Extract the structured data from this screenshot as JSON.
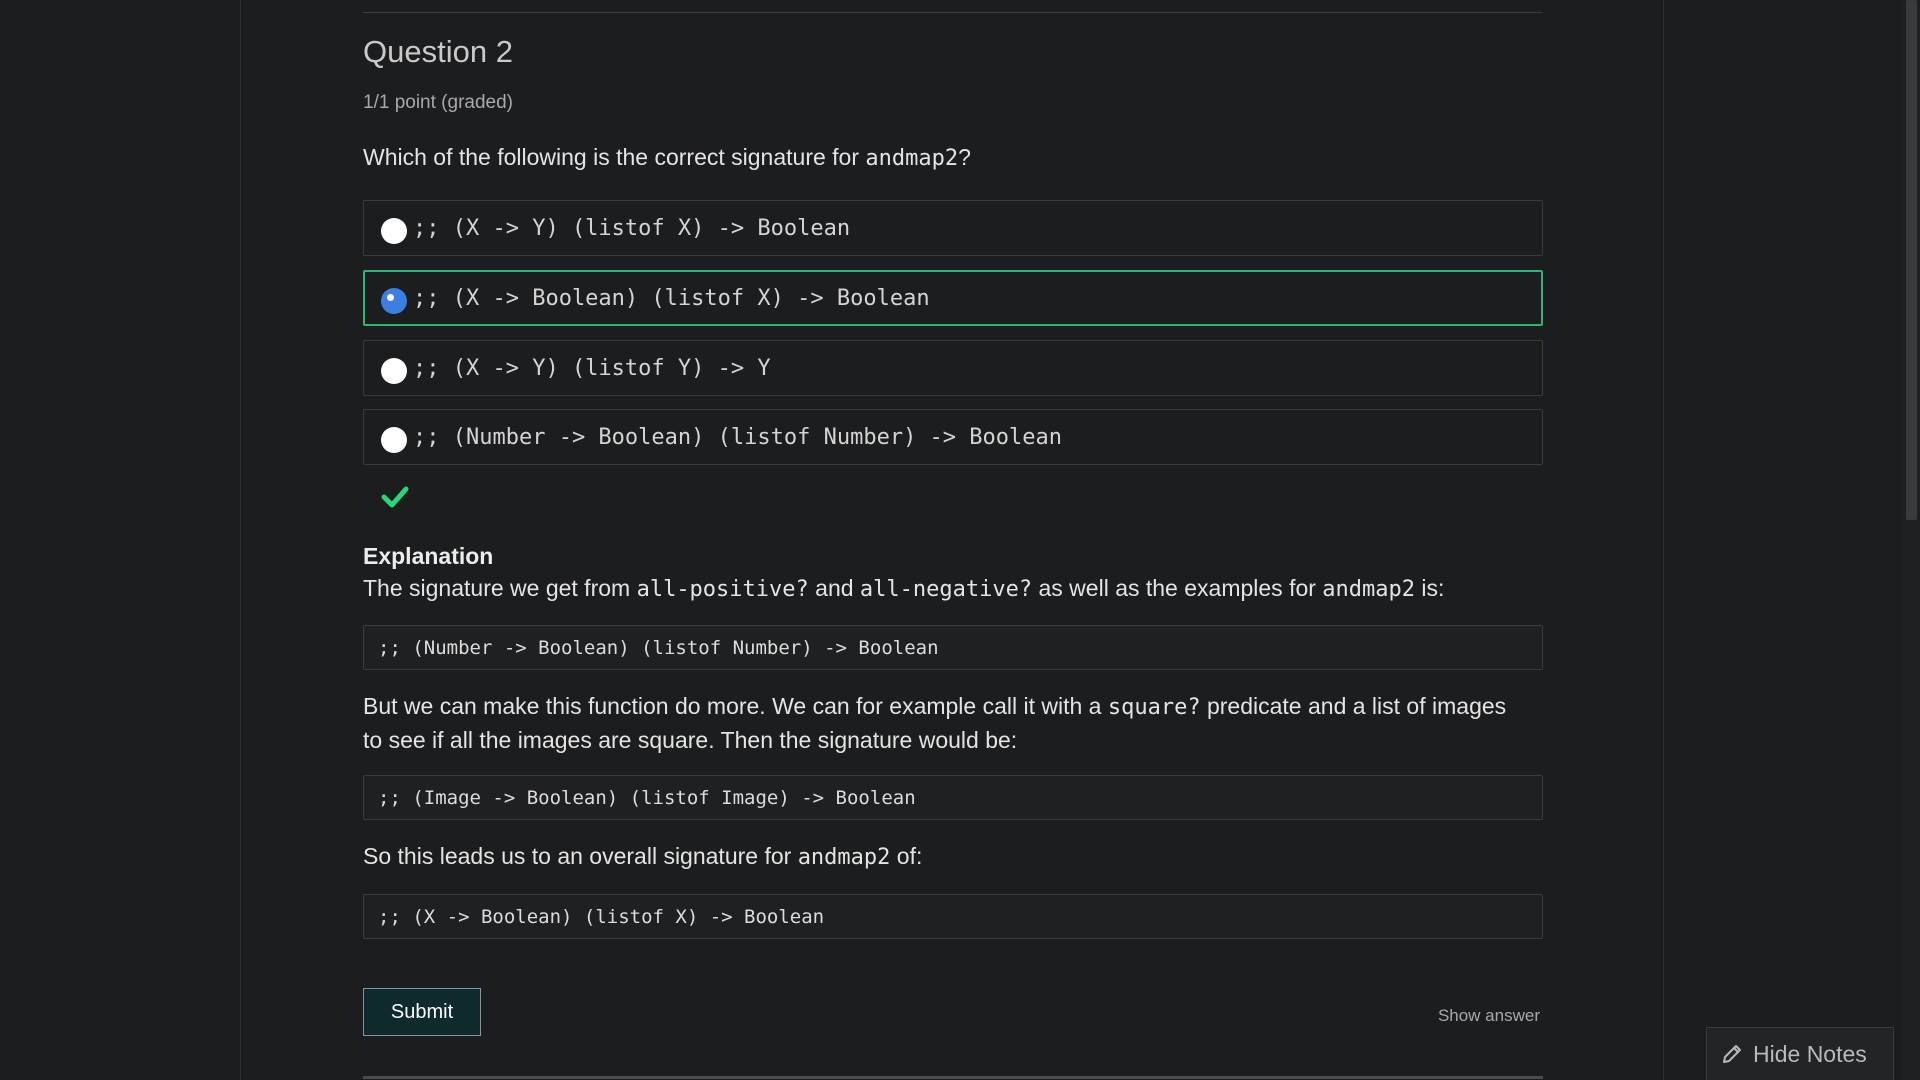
{
  "question": {
    "title": "Question 2",
    "points": "1/1 point (graded)",
    "prompt_prefix": "Which of the following is the correct signature for ",
    "prompt_code": "andmap2",
    "prompt_suffix": "?"
  },
  "options": [
    {
      "label": ";; (X -> Y) (listof X) -> Boolean",
      "selected": false
    },
    {
      "label": ";; (X -> Boolean) (listof X) -> Boolean",
      "selected": true
    },
    {
      "label": ";; (X -> Y) (listof Y) -> Y",
      "selected": false
    },
    {
      "label": ";; (Number -> Boolean) (listof Number) -> Boolean",
      "selected": false
    }
  ],
  "result": {
    "status_icon": "checkmark-icon",
    "color": "#2bd67b"
  },
  "explanation": {
    "heading": "Explanation",
    "p1": {
      "t1": "The signature we get from ",
      "c1": "all-positive?",
      "t2": " and ",
      "c2": "all-negative?",
      "t3": " as well as the examples for ",
      "c3": "andmap2",
      "t4": " is:"
    },
    "code1": ";; (Number -> Boolean) (listof Number) -> Boolean",
    "p2": {
      "t1": "But we can make this function do more. We can for example call it with a ",
      "c1": "square?",
      "t2": " predicate and a list of images to see if all the images are square. Then the signature would be:"
    },
    "code2": ";; (Image -> Boolean) (listof Image) -> Boolean",
    "p3": {
      "t1": "So this leads us to an overall signature for ",
      "c1": "andmap2",
      "t2": " of:"
    },
    "code3": ";; (X -> Boolean) (listof X) -> Boolean"
  },
  "actions": {
    "submit_label": "Submit",
    "show_answer_label": "Show answer"
  },
  "notes": {
    "hide_label": "Hide Notes",
    "icon": "pencil-icon"
  }
}
